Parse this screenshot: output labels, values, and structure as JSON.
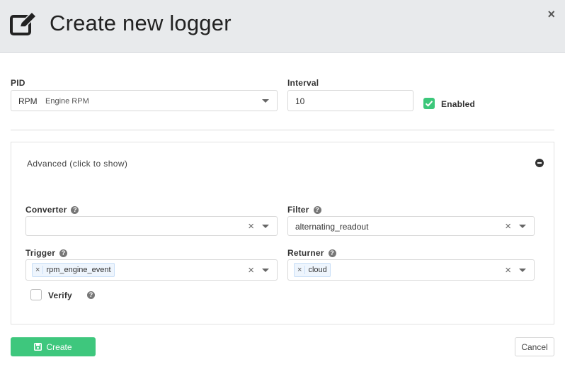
{
  "dialog": {
    "title": "Create new logger",
    "close_label": "×"
  },
  "pid": {
    "label": "PID",
    "code": "RPM",
    "description": "Engine RPM"
  },
  "interval": {
    "label": "Interval",
    "value": "10"
  },
  "enabled": {
    "label": "Enabled",
    "checked": true
  },
  "advanced": {
    "toggle_label": "Advanced (click to show)",
    "converter": {
      "label": "Converter",
      "value": ""
    },
    "filter": {
      "label": "Filter",
      "value": "alternating_readout"
    },
    "trigger": {
      "label": "Trigger",
      "tags": [
        "rpm_engine_event"
      ]
    },
    "returner": {
      "label": "Returner",
      "tags": [
        "cloud"
      ]
    },
    "verify": {
      "label": "Verify",
      "checked": false
    }
  },
  "footer": {
    "create_label": "Create",
    "cancel_label": "Cancel"
  },
  "glyphs": {
    "clear": "×",
    "help": "?",
    "tag_remove": "×"
  },
  "colors": {
    "accent": "#3ec77d",
    "header_bg": "#e8eaec"
  },
  "icons": {
    "title": "edit-icon",
    "create": "save-icon"
  }
}
